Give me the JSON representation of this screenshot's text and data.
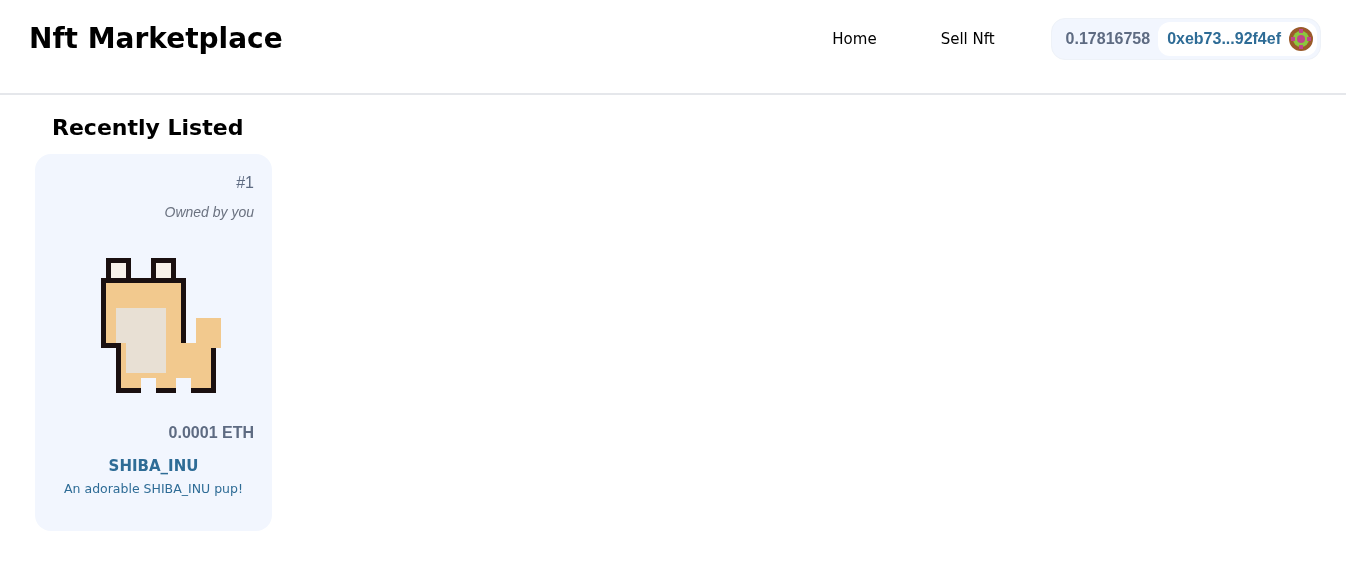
{
  "header": {
    "title": "Nft Marketplace",
    "nav": [
      {
        "label": "Home"
      },
      {
        "label": "Sell Nft"
      }
    ],
    "wallet": {
      "balance": "0.17816758",
      "address": "0xeb73...92f4ef"
    }
  },
  "section": {
    "title": "Recently Listed"
  },
  "listings": [
    {
      "token": "#1",
      "owner": "Owned by you",
      "price": "0.0001 ETH",
      "name": "SHIBA_INU",
      "description": "An adorable SHIBA_INU pup!"
    }
  ]
}
